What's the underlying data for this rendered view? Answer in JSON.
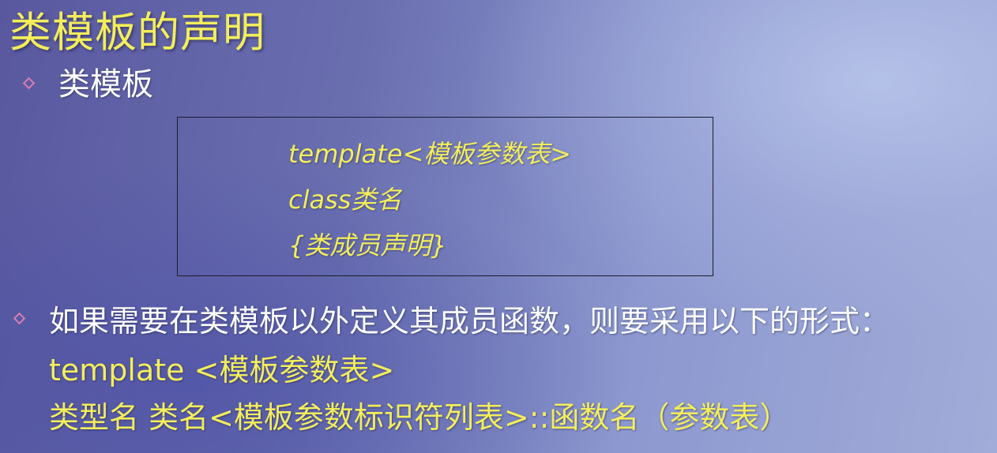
{
  "slide": {
    "title": "类模板的声明",
    "bullet1": "类模板",
    "code_box": {
      "lines": [
        "template<模板参数表>",
        "class类名",
        "{类成员声明}"
      ]
    },
    "bullet2": "如果需要在类模板以外定义其成员函数，则要采用以下的形式：",
    "form_lines": [
      "template <模板参数表>",
      "类型名 类名<模板参数标识符列表>::函数名（参数表）"
    ]
  },
  "colors": {
    "title": "#f3ee5a",
    "body_text": "#ffffff",
    "code_text": "#f3ee5a",
    "bullet_marker": "#d77fb3",
    "background_dark": "#59589f",
    "background_light": "#a2acd9"
  }
}
